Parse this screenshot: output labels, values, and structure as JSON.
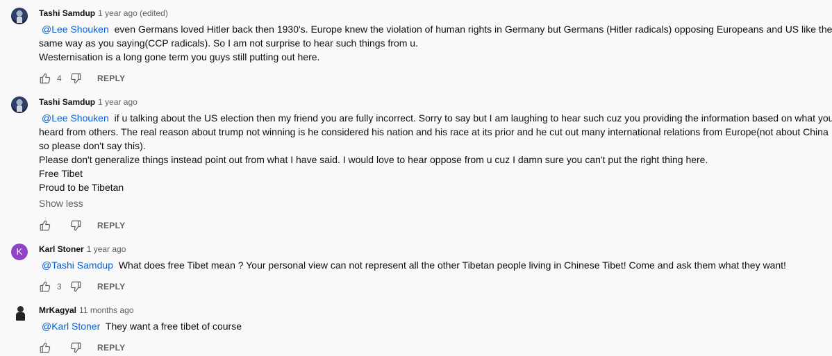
{
  "comments": [
    {
      "author": "Tashi Samdup",
      "time": "1 year ago (edited)",
      "mention": "@Lee Shouken",
      "lines": [
        "even Germans loved Hitler back then 1930's. Europe knew the violation of human rights in Germany but Germans (Hitler radicals) opposing Europeans and US like the",
        "same way as you saying(CCP  radicals). So I am not surprise to hear such things from u.",
        "Westernisation is a long gone term you guys still putting out here."
      ],
      "likes": "4",
      "reply_label": "REPLY"
    },
    {
      "author": "Tashi Samdup",
      "time": "1 year ago",
      "mention": "@Lee Shouken",
      "lines": [
        "if u talking about the US election then my friend you are fully incorrect. Sorry to say but I am laughing to hear such cuz you providing the information based on what you",
        "heard from others. The real reason about trump not winning is he considered his nation and his race at its prior and he cut out many international relations from Europe(not about China",
        "so please don't say this).",
        "Please don't generalize things instead point out from what I have said. I would love to hear oppose from u cuz I damn sure you can't put the right thing here.",
        "Free Tibet",
        "Proud to be Tibetan"
      ],
      "show_less": "Show less",
      "likes": "",
      "reply_label": "REPLY"
    },
    {
      "author": "Karl Stoner",
      "time": "1 year ago",
      "avatar_letter": "K",
      "mention": "@Tashi Samdup",
      "lines": [
        "What does free Tibet mean ? Your personal view can not represent all the other Tibetan people living in Chinese Tibet! Come and ask them what they want!"
      ],
      "likes": "3",
      "reply_label": "REPLY"
    },
    {
      "author": "MrKagyal",
      "time": "11 months ago",
      "mention": "@Karl Stoner",
      "lines": [
        "They want a free tibet of course"
      ],
      "likes": "",
      "reply_label": "REPLY"
    }
  ]
}
